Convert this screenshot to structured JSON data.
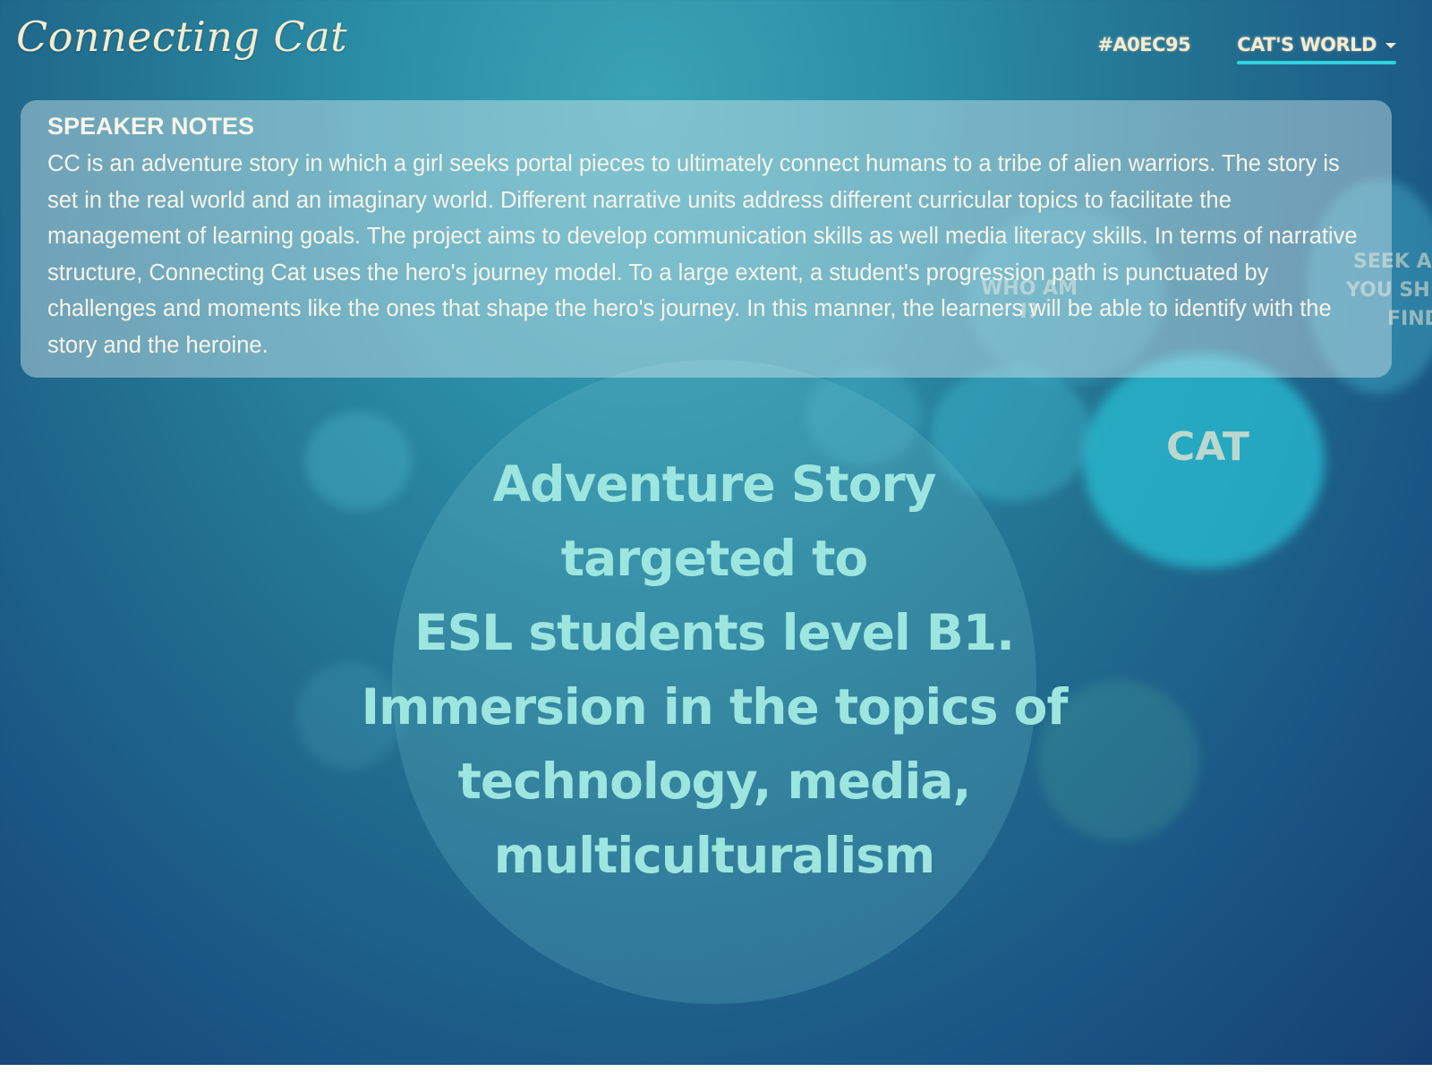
{
  "header": {
    "logo": "Connecting Cat",
    "nav": {
      "hex_link": "#A0EC95",
      "world_menu": "CAT'S WORLD"
    }
  },
  "background_labels": {
    "who_am_i": "WHO AM I?",
    "seek": "SEEK A",
    "you_sh": "YOU SH",
    "find": "FIND",
    "cat": "CAT"
  },
  "speaker_notes": {
    "title": "SPEAKER NOTES",
    "body": "CC is an adventure story in which a girl seeks portal pieces to ultimately connect humans to a tribe of alien warriors. The story is set in the real world and an imaginary world. Different narrative units address different curricular topics to facilitate the management of learning goals. The project aims to develop communication skills as well media literacy skills. In terms of narrative structure, Connecting Cat uses the hero's journey model. To a large extent, a student's progression path is punctuated by challenges and moments like the ones that shape the hero's journey. In this manner, the learners will be able to identify with the story and the heroine."
  },
  "main": {
    "lines": [
      "Adventure Story",
      "targeted to",
      "ESL students level B1.",
      "Immersion in the topics of",
      "technology, media,",
      "multiculturalism"
    ]
  },
  "colors": {
    "accent_underline": "#2ed3dd",
    "main_text": "#9de6e0",
    "cream_text": "#f4ecd0"
  }
}
